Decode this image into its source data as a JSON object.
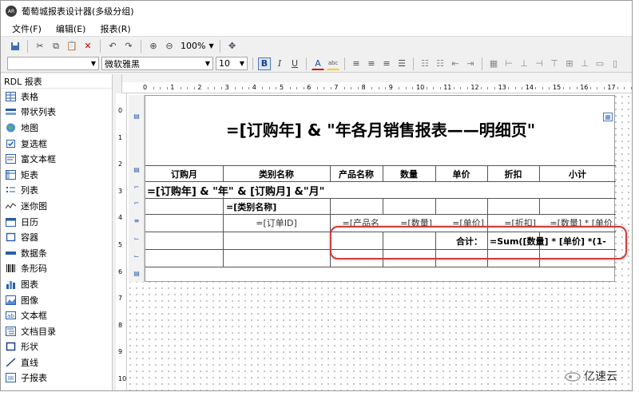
{
  "window": {
    "title": "葡萄城报表设计器(多级分组)"
  },
  "menu": [
    "文件(F)",
    "编辑(E)",
    "报表(R)"
  ],
  "toolbar": {
    "zoom": "100%",
    "font_name": "微软雅黑",
    "font_size": "10"
  },
  "toolbox": {
    "header": "RDL 报表",
    "items": [
      {
        "label": "表格",
        "icon": "table-icon"
      },
      {
        "label": "带状列表",
        "icon": "banded-list-icon"
      },
      {
        "label": "地图",
        "icon": "map-icon"
      },
      {
        "label": "复选框",
        "icon": "checkbox-icon"
      },
      {
        "label": "富文本框",
        "icon": "rich-textbox-icon"
      },
      {
        "label": "矩表",
        "icon": "matrix-icon"
      },
      {
        "label": "列表",
        "icon": "list-icon"
      },
      {
        "label": "迷你图",
        "icon": "sparkline-icon"
      },
      {
        "label": "日历",
        "icon": "calendar-icon"
      },
      {
        "label": "容器",
        "icon": "container-icon"
      },
      {
        "label": "数据条",
        "icon": "databar-icon"
      },
      {
        "label": "条形码",
        "icon": "barcode-icon"
      },
      {
        "label": "图表",
        "icon": "chart-icon"
      },
      {
        "label": "图像",
        "icon": "image-icon"
      },
      {
        "label": "文本框",
        "icon": "textbox-icon"
      },
      {
        "label": "文档目录",
        "icon": "toc-icon"
      },
      {
        "label": "形状",
        "icon": "shape-icon"
      },
      {
        "label": "直线",
        "icon": "line-icon"
      },
      {
        "label": "子报表",
        "icon": "subreport-icon"
      }
    ]
  },
  "hruler": [
    "0",
    "1",
    "2",
    "3",
    "4",
    "5",
    "6",
    "7",
    "8",
    "9",
    "10",
    "11",
    "12",
    "13",
    "14",
    "15",
    "16",
    "17"
  ],
  "vruler": [
    "0",
    "1",
    "2",
    "3",
    "4",
    "5",
    "6",
    "7",
    "8",
    "9",
    "10"
  ],
  "report": {
    "title": "=[订购年] & \"年各月销售报表——明细页\"",
    "headers": [
      "订购月",
      "类别名称",
      "产品名称",
      "数量",
      "单价",
      "折扣",
      "小计"
    ],
    "group1": "=[订购年] & \"年\"  & [订购月]  &\"月\"",
    "group2": "=[类别名称]",
    "detail": [
      "=[订单ID]",
      "=[产品名",
      "=[数量]",
      "=[单价]",
      "=[折扣]",
      "=[数量] * [单价"
    ],
    "total_label": "合计：",
    "total_expr": "=Sum([数量] * [单价] *(1-"
  },
  "watermark": "亿速云"
}
